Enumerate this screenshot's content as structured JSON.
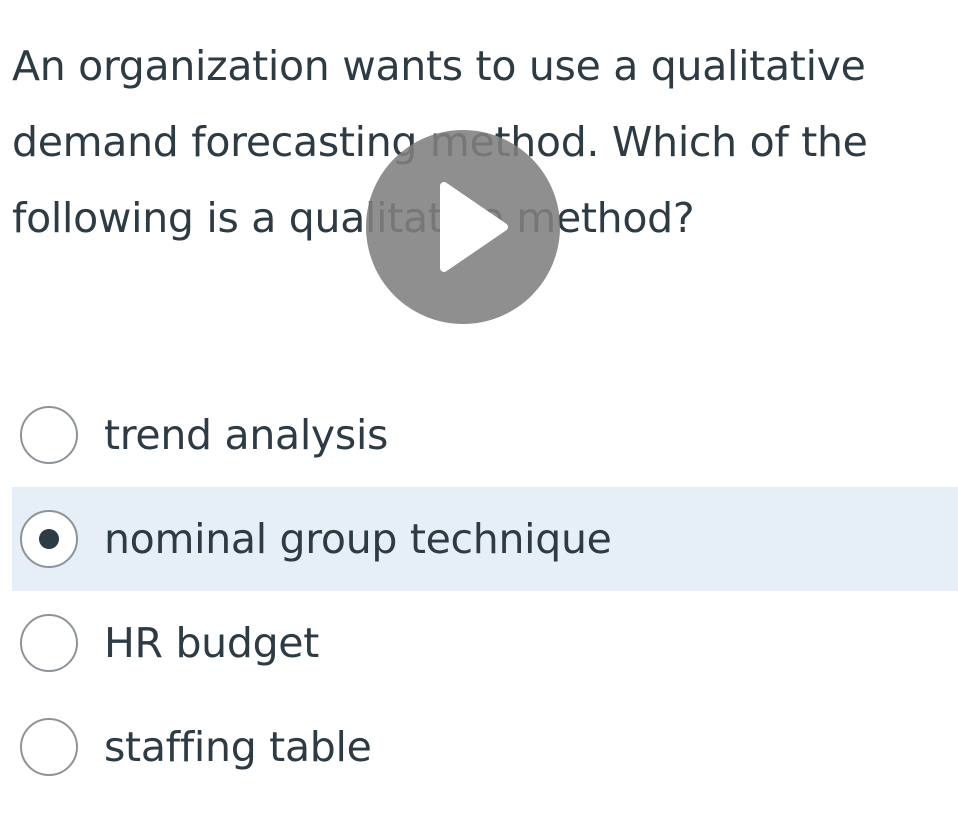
{
  "question": {
    "text": "An organization wants to use a qualitative demand forecasting method. Which of the following is a qualitative method?"
  },
  "answers": [
    {
      "label": "trend analysis",
      "selected": false
    },
    {
      "label": "nominal group technique",
      "selected": true
    },
    {
      "label": "HR budget",
      "selected": false
    },
    {
      "label": "staffing table",
      "selected": false
    }
  ],
  "video_overlay": {
    "icon": "play-icon"
  },
  "colors": {
    "text": "#2d3b45",
    "selected_background": "#e6eef7",
    "radio_border": "#8c949a",
    "overlay": "#808080"
  }
}
